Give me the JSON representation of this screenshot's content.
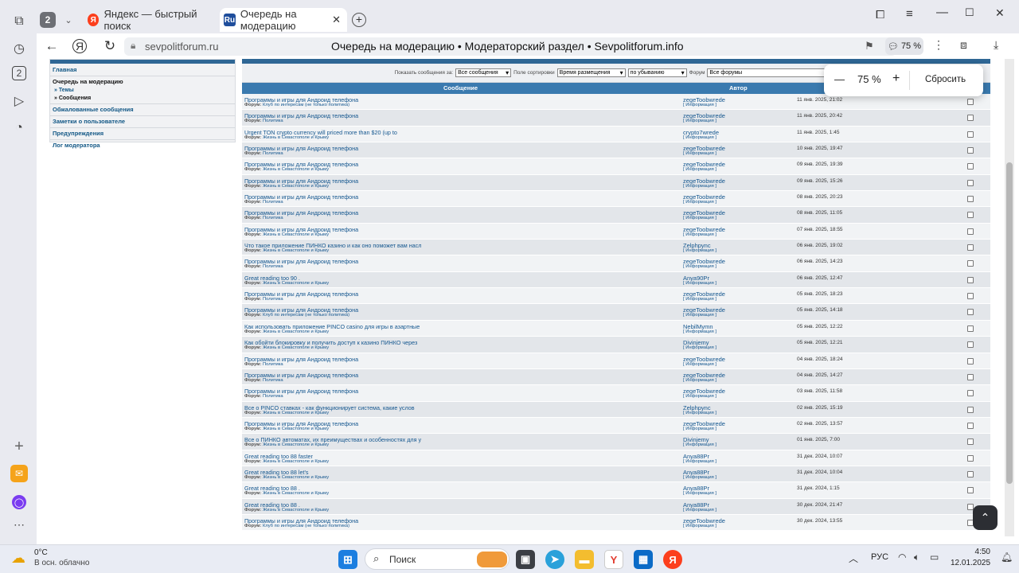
{
  "tabs": {
    "group_count": "2",
    "items": [
      {
        "title": "Яндекс — быстрый поиск",
        "favicon": "Я"
      },
      {
        "title": "Очередь на модерацию",
        "favicon": "Ru"
      }
    ]
  },
  "addressbar": {
    "url": "sevpolitforum.ru",
    "page_title": "Очередь на модерацию • Модераторский раздел • Sevpolitforum.info",
    "zoom": "75 %"
  },
  "zoom_popup": {
    "minus": "—",
    "value": "75 %",
    "plus": "+",
    "reset": "Сбросить"
  },
  "sidebar": {
    "home": "Главная",
    "queue": "Очередь на модерацию",
    "topics": "» Темы",
    "messages": "» Сообщения",
    "reported": "Обжалованные сообщения",
    "notes": "Заметки о пользователе",
    "warnings": "Предупреждения",
    "log": "Лог модератора"
  },
  "filters": {
    "show_label": "Показать сообщения за:",
    "show_value": "Все сообщения",
    "sort_label": "Поле сортировки",
    "sort_value": "Время размещения",
    "order_value": "по убыванию",
    "forum_label": "Форум",
    "forum_value": "Все форумы"
  },
  "table": {
    "col_message": "Сообщение",
    "col_author": "Автор",
    "forum_prefix": "Форум:",
    "info_label": "[ Информация ]",
    "rows": [
      {
        "title": "Программы и игры для Андроид телефона",
        "forum": "Клуб по интересам (не только политика)",
        "author": "zegeToobwrede",
        "date": "11 янв. 2025, 21:02"
      },
      {
        "title": "Программы и игры для Андроид телефона",
        "forum": "Политика",
        "author": "zegeToobwrede",
        "date": "11 янв. 2025, 20:42"
      },
      {
        "title": "Urgent TON crypto currency will priced more than $20 (up to",
        "forum": "Жизнь в Севастополе и Крыму",
        "author": "crypto7wrede",
        "date": "11 янв. 2025, 1:45"
      },
      {
        "title": "Программы и игры для Андроид телефона",
        "forum": "Политика",
        "author": "zegeToobwrede",
        "date": "10 янв. 2025, 19:47"
      },
      {
        "title": "Программы и игры для Андроид телефона",
        "forum": "Жизнь в Севастополе и Крыму",
        "author": "zegeToobwrede",
        "date": "09 янв. 2025, 19:39"
      },
      {
        "title": "Программы и игры для Андроид телефона",
        "forum": "Жизнь в Севастополе и Крыму",
        "author": "zegeToobwrede",
        "date": "09 янв. 2025, 15:26"
      },
      {
        "title": "Программы и игры для Андроид телефона",
        "forum": "Политика",
        "author": "zegeToobwrede",
        "date": "08 янв. 2025, 20:23"
      },
      {
        "title": "Программы и игры для Андроид телефона",
        "forum": "Политика",
        "author": "zegeToobwrede",
        "date": "08 янв. 2025, 11:05"
      },
      {
        "title": "Программы и игры для Андроид телефона",
        "forum": "Жизнь в Севастополе и Крыму",
        "author": "zegeToobwrede",
        "date": "07 янв. 2025, 18:55"
      },
      {
        "title": "Что такое приложение ПИНКО казино и как оно поможет вам насл",
        "forum": "Жизнь в Севастополе и Крыму",
        "author": "Zelphpync",
        "date": "06 янв. 2025, 19:02"
      },
      {
        "title": "Программы и игры для Андроид телефона",
        "forum": "Политика",
        "author": "zegeToobwrede",
        "date": "06 янв. 2025, 14:23"
      },
      {
        "title": "Great reading too 90 .",
        "forum": "Жизнь в Севастополе и Крыму",
        "author": "Anya90Pr",
        "date": "06 янв. 2025, 12:47"
      },
      {
        "title": "Программы и игры для Андроид телефона",
        "forum": "Политика",
        "author": "zegeToobwrede",
        "date": "05 янв. 2025, 18:23"
      },
      {
        "title": "Программы и игры для Андроид телефона",
        "forum": "Клуб по интересам (не только политика)",
        "author": "zegeToobwrede",
        "date": "05 янв. 2025, 14:18"
      },
      {
        "title": "Как использовать приложение PINCO casino для игры в азартные",
        "forum": "Жизнь в Севастополе и Крыму",
        "author": "NebilMymn",
        "date": "05 янв. 2025, 12:22"
      },
      {
        "title": "Как обойти блокировку и получить доступ к казино ПИНКО через",
        "forum": "Жизнь в Севастополе и Крыму",
        "author": "Divinjemy",
        "date": "05 янв. 2025, 12:21"
      },
      {
        "title": "Программы и игры для Андроид телефона",
        "forum": "Политика",
        "author": "zegeToobwrede",
        "date": "04 янв. 2025, 18:24"
      },
      {
        "title": "Программы и игры для Андроид телефона",
        "forum": "Политика",
        "author": "zegeToobwrede",
        "date": "04 янв. 2025, 14:27"
      },
      {
        "title": "Программы и игры для Андроид телефона",
        "forum": "Политика",
        "author": "zegeToobwrede",
        "date": "03 янв. 2025, 11:58"
      },
      {
        "title": "Все о PINCO ставках - как функционирует система, какие услов",
        "forum": "Жизнь в Севастополе и Крыму",
        "author": "Zelphpync",
        "date": "02 янв. 2025, 15:19"
      },
      {
        "title": "Программы и игры для Андроид телефона",
        "forum": "Жизнь в Севастополе и Крыму",
        "author": "zegeToobwrede",
        "date": "02 янв. 2025, 13:57"
      },
      {
        "title": "Все о ПИНКО автоматах, их преимуществах и особенностях для у",
        "forum": "Жизнь в Севастополе и Крыму",
        "author": "Divinjemy",
        "date": "01 янв. 2025, 7:00"
      },
      {
        "title": "Great reading too 88 faster",
        "forum": "Жизнь в Севастополе и Крыму",
        "author": "Anya88Pr",
        "date": "31 дек. 2024, 10:07"
      },
      {
        "title": "Great reading too 88 let's",
        "forum": "Жизнь в Севастополе и Крыму",
        "author": "Anya88Pr",
        "date": "31 дек. 2024, 10:04"
      },
      {
        "title": "Great reading too 88 .",
        "forum": "Жизнь в Севастополе и Крыму",
        "author": "Anya88Pr",
        "date": "31 дек. 2024, 1:15"
      },
      {
        "title": "Great reading too 88 .",
        "forum": "Жизнь в Севастополе и Крыму",
        "author": "Anya88Pr",
        "date": "30 дек. 2024, 21:47"
      },
      {
        "title": "Программы и игры для Андроид телефона",
        "forum": "Клуб по интересам (не только политика)",
        "author": "zegeToobwrede",
        "date": "30 дек. 2024, 13:55"
      }
    ]
  },
  "taskbar": {
    "weather_temp": "0°C",
    "weather_desc": "В осн. облачно",
    "search_placeholder": "Поиск",
    "lang": "РУС",
    "time": "4:50",
    "date": "12.01.2025"
  },
  "colors": {
    "header_blue": "#3a7aaf",
    "link": "#15578f"
  }
}
